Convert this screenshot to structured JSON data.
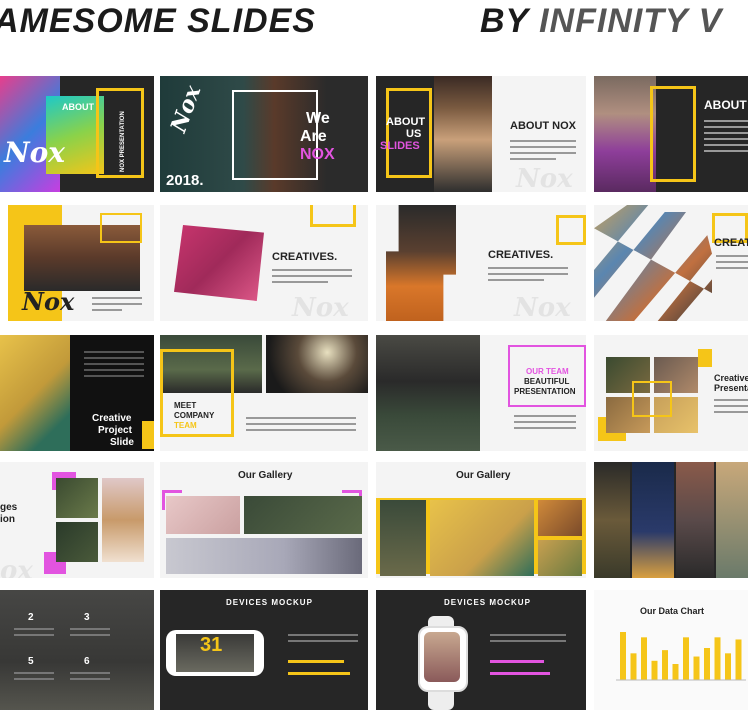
{
  "header": {
    "left": "AMESOME SLIDES",
    "right_a": "BY ",
    "right_b": "INFINITY V"
  },
  "s1": {
    "about": "ABOUT",
    "side": "NOX PRESENTATION",
    "script": "Nox"
  },
  "s2": {
    "l1": "We",
    "l2": "Are",
    "l3": "NOX",
    "year": "2018.",
    "script": "Nox"
  },
  "s3": {
    "l1": "ABOUT",
    "l2": "US",
    "l3": "SLIDES",
    "title": "ABOUT NOX",
    "ghost": "Nox"
  },
  "s4": {
    "title": "ABOUT N",
    "side": "NOX PRESENTATION"
  },
  "s5": {
    "script": "Nox"
  },
  "s6": {
    "title": "CREATIVES.",
    "ghost": "Nox"
  },
  "s7": {
    "title": "CREATIVES.",
    "ghost": "Nox"
  },
  "s8": {
    "title": "CREAT"
  },
  "s9": {
    "l1": "Creative",
    "l2": "Project",
    "l3": "Slide"
  },
  "s10": {
    "l1": "MEET",
    "l2": "COMPANY",
    "l3": "TEAM"
  },
  "s11": {
    "l1": "OUR TEAM",
    "l2": "BEAUTIFUL",
    "l3": "PRESENTATION"
  },
  "s12": {
    "l1": "Creative",
    "l2": "Presentat"
  },
  "s13": {
    "l1": "ges",
    "l2": "ion",
    "ghost": "ox"
  },
  "s14": {
    "title": "Our Gallery"
  },
  "s15": {
    "title": "Our Gallery"
  },
  "s17": {
    "n2": "2",
    "n3": "3",
    "n5": "5",
    "n6": "6"
  },
  "s18": {
    "title": "DEVICES MOCKUP",
    "digits": "31"
  },
  "s19": {
    "title": "DEVICES MOCKUP"
  },
  "s20": {
    "title": "Our Data Chart"
  },
  "chart_data": {
    "type": "bar",
    "title": "Our Data Chart",
    "values": [
      45,
      25,
      40,
      18,
      28,
      15,
      40,
      22,
      30,
      40,
      25,
      38
    ]
  }
}
